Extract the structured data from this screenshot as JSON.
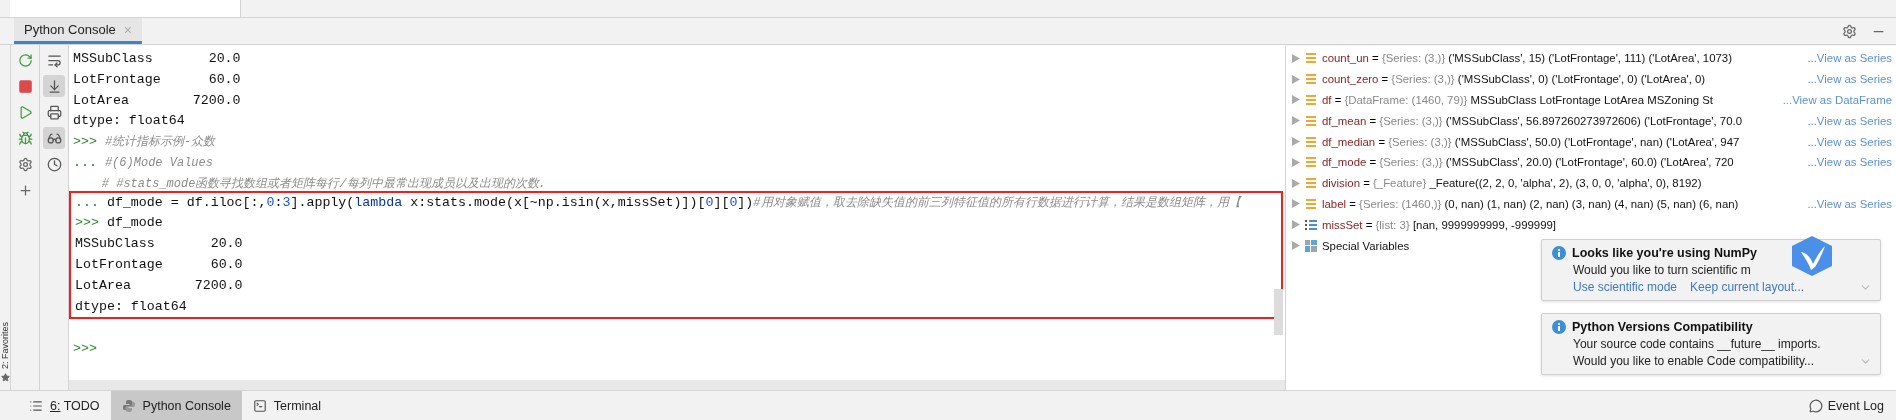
{
  "top_tab": {
    "label": "Python Console",
    "close": "×",
    "selected": true
  },
  "left_tools": [
    {
      "on": false
    },
    {
      "on": false
    },
    {
      "on": false
    },
    {
      "on": false
    },
    {
      "on": false
    },
    {
      "on": false
    }
  ],
  "right_tools": [
    {
      "on": false
    },
    {
      "on": true
    },
    {
      "on": false
    },
    {
      "on": true
    },
    {
      "on": false
    }
  ],
  "side_strip": {
    "label": "2: Favorites"
  },
  "console_lines": [
    {
      "segments": [
        {
          "kind": "output",
          "text": "MSSubClass       20.0"
        }
      ]
    },
    {
      "segments": [
        {
          "kind": "output",
          "text": "LotFrontage      60.0"
        }
      ]
    },
    {
      "segments": [
        {
          "kind": "output",
          "text": "LotArea        7200.0"
        }
      ]
    },
    {
      "segments": [
        {
          "kind": "output",
          "text": "dtype: float64"
        }
      ]
    },
    {
      "segments": [
        {
          "kind": "prompt",
          "text": ">>> "
        },
        {
          "kind": "comment",
          "text": "#统计指标示例-众数"
        }
      ]
    },
    {
      "segments": [
        {
          "kind": "prompt",
          "text": "... "
        },
        {
          "kind": "comment",
          "text": "#(6)Mode Values"
        }
      ]
    },
    {
      "segments": [
        {
          "kind": "comment",
          "text": "    # #stats_mode函数寻找数组或者矩阵每行/每列中最常出现成员以及出现的次数."
        }
      ]
    }
  ],
  "highlighted_lines": [
    {
      "segments": [
        {
          "kind": "prompt",
          "text": "... "
        },
        {
          "kind": "code",
          "text": "df_mode = df.iloc[:,"
        },
        {
          "kind": "number",
          "text": "0"
        },
        {
          "kind": "code",
          "text": ":"
        },
        {
          "kind": "number",
          "text": "3"
        },
        {
          "kind": "code",
          "text": "].apply("
        },
        {
          "kind": "keyword",
          "text": "lambda"
        },
        {
          "kind": "code",
          "text": " x:stats.mode(x[~np.isin(x,missSet)])["
        },
        {
          "kind": "number",
          "text": "0"
        },
        {
          "kind": "code",
          "text": "]["
        },
        {
          "kind": "number",
          "text": "0"
        },
        {
          "kind": "code",
          "text": "])"
        },
        {
          "kind": "comment",
          "text": "#用对象赋值，取去除缺失值的前三列特征值的所有行数据进行计算，结果是数组矩阵，用【"
        }
      ]
    },
    {
      "segments": [
        {
          "kind": "prompt",
          "text": ">>> "
        },
        {
          "kind": "code",
          "text": "df_mode"
        }
      ]
    },
    {
      "segments": [
        {
          "kind": "output",
          "text": "MSSubClass       20.0"
        }
      ]
    },
    {
      "segments": [
        {
          "kind": "output",
          "text": "LotFrontage      60.0"
        }
      ]
    },
    {
      "segments": [
        {
          "kind": "output",
          "text": "LotArea        7200.0"
        }
      ]
    },
    {
      "segments": [
        {
          "kind": "output",
          "text": "dtype: float64"
        }
      ]
    }
  ],
  "input_prompt": ">>>",
  "variables": [
    {
      "kind": "series",
      "name": "count_un",
      "equals": "=",
      "type": "{Series: (3,)}",
      "value": "('MSSubClass', 15) ('LotFrontage', 111) ('LotArea', 1073)",
      "link": "...View as Series"
    },
    {
      "kind": "series",
      "name": "count_zero",
      "equals": "=",
      "type": "{Series: (3,)}",
      "value": "('MSSubClass', 0) ('LotFrontage', 0) ('LotArea', 0)",
      "link": "...View as Series"
    },
    {
      "kind": "series",
      "name": "df",
      "equals": "=",
      "type": "{DataFrame: (1460, 79)}",
      "value": "MSSubClass LotFrontage LotArea MSZoning St",
      "link": "...View as DataFrame"
    },
    {
      "kind": "series",
      "name": "df_mean",
      "equals": "=",
      "type": "{Series: (3,)}",
      "value": "('MSSubClass', 56.897260273972606) ('LotFrontage', 70.0",
      "link": "...View as Series"
    },
    {
      "kind": "series",
      "name": "df_median",
      "equals": "=",
      "type": "{Series: (3,)}",
      "value": "('MSSubClass', 50.0) ('LotFrontage', nan) ('LotArea', 947",
      "link": "...View as Series"
    },
    {
      "kind": "series",
      "name": "df_mode",
      "equals": "=",
      "type": "{Series: (3,)}",
      "value": "('MSSubClass', 20.0) ('LotFrontage', 60.0) ('LotArea', 720",
      "link": "...View as Series"
    },
    {
      "kind": "series",
      "name": "division",
      "equals": "=",
      "type": "{_Feature}",
      "value": "_Feature((2, 2, 0, 'alpha', 2), (3, 0, 0, 'alpha', 0), 8192)"
    },
    {
      "kind": "series",
      "name": "label",
      "equals": "=",
      "type": "{Series: (1460,)}",
      "value": "(0, nan) (1, nan) (2, nan) (3, nan) (4, nan) (5, nan) (6, nan)",
      "link": "...View as Series"
    },
    {
      "kind": "list",
      "name": "missSet",
      "equals": "=",
      "type": "{list: 3}",
      "value": "[nan, 9999999999, -999999]"
    },
    {
      "kind": "special",
      "name": "Special Variables"
    }
  ],
  "notifications": [
    {
      "title": "Looks like you're using NumPy",
      "lines": [
        "Would you like to turn scientific m"
      ],
      "actions": [
        "Use scientific mode",
        "Keep current layout..."
      ]
    },
    {
      "title": "Python Versions Compatibility",
      "lines": [
        "Your source code contains __future__ imports.",
        "Would you like to enable Code compatibility..."
      ]
    }
  ],
  "bottom_tabs": [
    {
      "kind": "todo",
      "label": "6: TODO",
      "mnemonic": true,
      "selected": false
    },
    {
      "kind": "python",
      "label": "Python Console",
      "mnemonic": false,
      "selected": true
    },
    {
      "kind": "terminal",
      "label": "Terminal",
      "mnemonic": false,
      "selected": false
    }
  ],
  "event_log": "Event Log"
}
